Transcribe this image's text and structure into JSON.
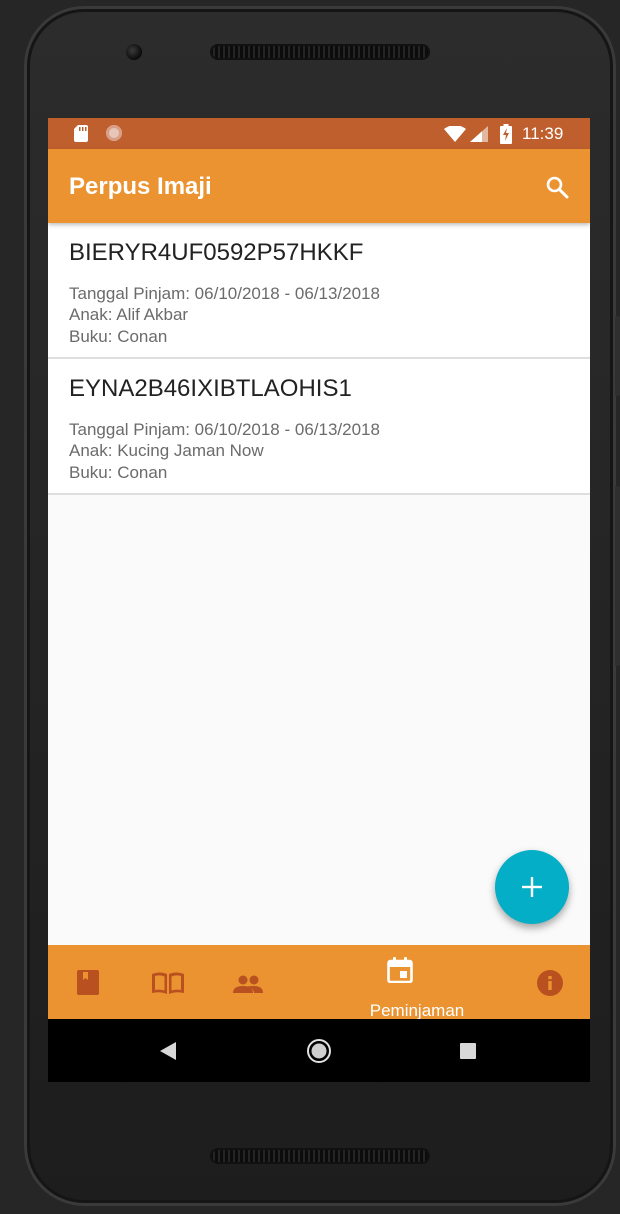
{
  "status_bar": {
    "time": "11:39",
    "icons": [
      "sd-card-icon",
      "notification-dot-icon",
      "wifi-icon",
      "signal-icon",
      "battery-charging-icon"
    ]
  },
  "app_bar": {
    "title": "Perpus Imaji",
    "action_icon": "search-icon"
  },
  "loans": [
    {
      "code": "BIERYR4UF0592P57HKKF",
      "dates": "Tanggal Pinjam: 06/10/2018 - 06/13/2018",
      "child": "Anak: Alif Akbar",
      "book": "Buku: Conan"
    },
    {
      "code": "EYNA2B46IXIBTLAOHIS1",
      "dates": "Tanggal Pinjam: 06/10/2018 - 06/13/2018",
      "child": "Anak: Kucing Jaman Now",
      "book": "Buku: Conan"
    }
  ],
  "fab": {
    "icon": "plus-icon"
  },
  "bottom_nav": {
    "items": [
      {
        "icon": "book-icon",
        "label": ""
      },
      {
        "icon": "open-book-icon",
        "label": ""
      },
      {
        "icon": "people-icon",
        "label": ""
      },
      {
        "icon": "calendar-icon",
        "label": "Peminjaman",
        "selected": true
      },
      {
        "icon": "info-icon",
        "label": ""
      }
    ]
  },
  "system_nav": {
    "icons": [
      "back-icon",
      "home-icon",
      "recents-icon"
    ]
  },
  "colors": {
    "status_bar": "#bf5f2e",
    "primary": "#ea9330",
    "fab": "#03aec6",
    "nav_icon_inactive": "#b8501f"
  }
}
